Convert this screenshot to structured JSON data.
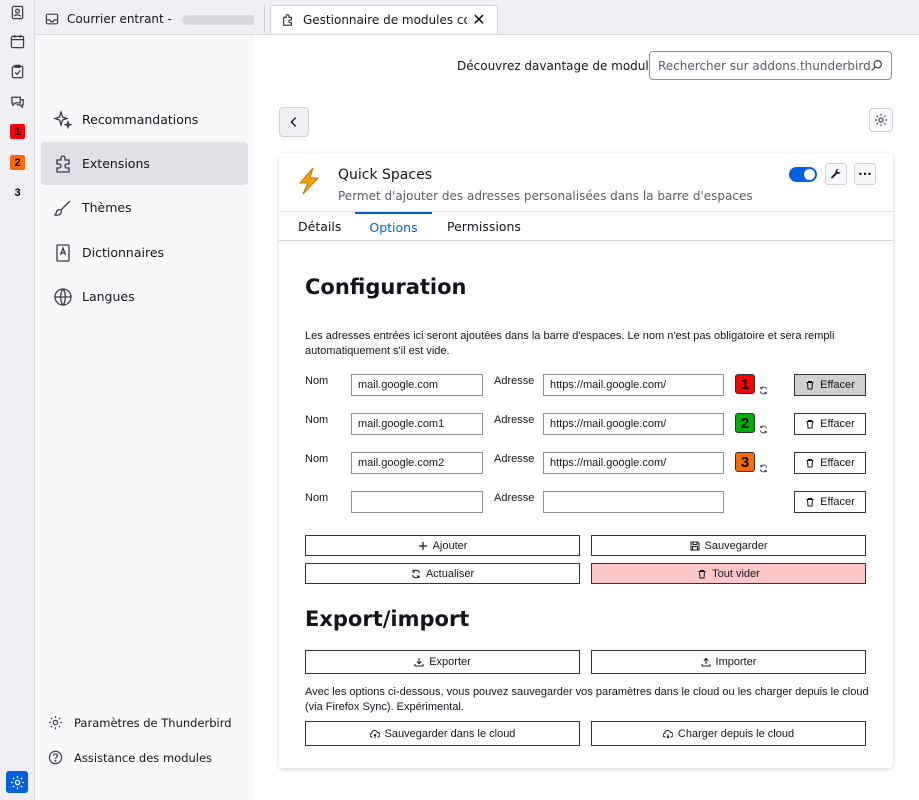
{
  "spaces": {
    "badges": [
      {
        "label": "1",
        "color": "#ff0000"
      },
      {
        "label": "2",
        "color": "#00b000"
      },
      {
        "label": "3",
        "color": "#ff6a00"
      }
    ]
  },
  "tabs": [
    {
      "label": "Courrier entrant - "
    },
    {
      "label": "Gestionnaire de modules complémentaires"
    }
  ],
  "nav": {
    "items": [
      {
        "label": "Recommandations"
      },
      {
        "label": "Extensions"
      },
      {
        "label": "Thèmes"
      },
      {
        "label": "Dictionnaires"
      },
      {
        "label": "Langues"
      }
    ],
    "footer": [
      {
        "label": "Paramètres de Thunderbird"
      },
      {
        "label": "Assistance des modules"
      }
    ]
  },
  "header": {
    "discover": "Découvrez davantage de modules",
    "search_placeholder": "Rechercher sur addons.thunderbird.net"
  },
  "addon": {
    "name": "Quick Spaces",
    "description": "Permet d'ajouter des adresses personalisées dans la barre d'espaces",
    "enabled": true,
    "more_label": "···",
    "tabs": [
      "Détails",
      "Options",
      "Permissions"
    ],
    "active_tab": "Options"
  },
  "options": {
    "title": "Configuration",
    "intro": "Les adresses entrées ici seront ajoutées dans la barre d'espaces. Le nom n'est pas obligatoire et sera rempli automatiquement s'il est vide.",
    "name_label": "Nom",
    "address_label": "Adresse",
    "erase_label": "Effacer",
    "rows": [
      {
        "name": "mail.google.com",
        "address": "https://mail.google.com/",
        "badge": "1",
        "badge_color": "#ff0000"
      },
      {
        "name": "mail.google.com1",
        "address": "https://mail.google.com/",
        "badge": "2",
        "badge_color": "#00b000"
      },
      {
        "name": "mail.google.com2",
        "address": "https://mail.google.com/",
        "badge": "3",
        "badge_color": "#ff6a00"
      },
      {
        "name": "",
        "address": "",
        "badge": "",
        "badge_color": ""
      }
    ],
    "add_label": "Ajouter",
    "save_label": "Sauvegarder",
    "refresh_label": "Actualiser",
    "clear_all_label": "Tout vider",
    "export_title": "Export/import",
    "export_label": "Exporter",
    "import_label": "Importer",
    "cloud_text": "Avec les options ci-dessous, vous pouvez sauvegarder vos paramètres dans le cloud ou les charger depuis le cloud (via Firefox Sync). Expérimental.",
    "cloud_save_label": "Sauvegarder dans le cloud",
    "cloud_load_label": "Charger depuis le cloud"
  }
}
